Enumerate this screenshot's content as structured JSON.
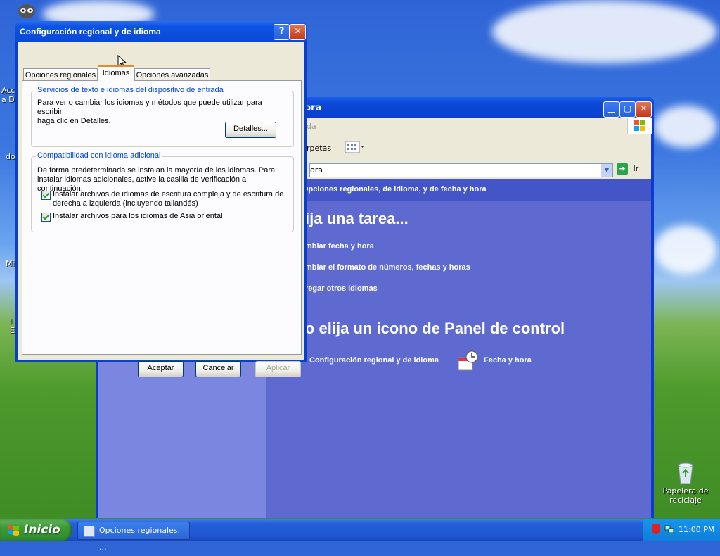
{
  "desktop": {
    "icons": [
      {
        "label": "Acc a Di",
        "icon": "internet-icon"
      },
      {
        "label": "do",
        "icon": "folder-icon"
      },
      {
        "label": "Mi",
        "icon": "computer-icon"
      },
      {
        "label": "I E",
        "icon": "ie-icon"
      },
      {
        "label": "Papelera de reciclaje",
        "icon": "recycle-bin-icon"
      }
    ]
  },
  "back_window": {
    "title": "hora",
    "menu_text": "da",
    "toolbar_folders": "rpetas",
    "address_value": "ora",
    "go_label": "Ir",
    "header_link": "Opciones regionales, de idioma, y de fecha y hora",
    "task_heading": "ija una tarea...",
    "tasks": [
      "mbiar fecha y hora",
      "mbiar el formato de números, fechas y horas",
      "regar otros idiomas"
    ],
    "icon_heading": "o elija un icono de Panel de control",
    "cp_icons": [
      {
        "label": "Configuración regional y de idioma",
        "icon": "globe-icon"
      },
      {
        "label": "Fecha y hora",
        "icon": "clock-calendar-icon"
      }
    ]
  },
  "dialog": {
    "title": "Configuración regional y de idioma",
    "help_glyph": "?",
    "close_glyph": "✕",
    "tabs": [
      {
        "label": "Opciones regionales",
        "active": false
      },
      {
        "label": "Idiomas",
        "active": true
      },
      {
        "label": "Opciones avanzadas",
        "active": false
      }
    ],
    "group1": {
      "label": "Servicios de texto e idiomas del dispositivo de entrada",
      "text_line1": "Para ver o cambiar los idiomas y métodos que puede utilizar para escribir,",
      "text_line2": "haga clic en Detalles.",
      "details_button": "Detalles..."
    },
    "group2": {
      "label": "Compatibilidad con idioma adicional",
      "text_line1": "De forma predeterminada se instalan la mayoría de los idiomas. Para",
      "text_line2": "instalar idiomas adicionales, active la casilla de verificación a continuación.",
      "checkbox1_line1": "Instalar archivos de idiomas de escritura compleja y de escritura de",
      "checkbox1_line2": "derecha a izquierda (incluyendo tailandés)",
      "checkbox1_checked": true,
      "checkbox2": "Instalar archivos para los idiomas de Asia oriental",
      "checkbox2_checked": true
    },
    "buttons": {
      "ok": "Aceptar",
      "cancel": "Cancelar",
      "apply": "Aplicar"
    }
  },
  "taskbar": {
    "start_label": "Inicio",
    "task_button": "Opciones regionales, ...",
    "clock": "11:00 PM"
  }
}
